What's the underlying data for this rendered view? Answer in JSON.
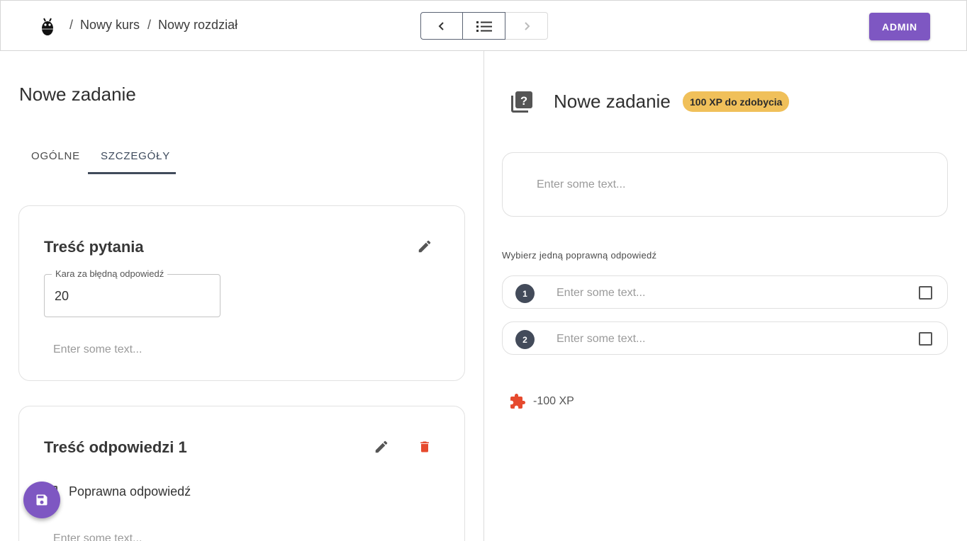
{
  "header": {
    "breadcrumb": [
      "Nowy kurs",
      "Nowy rozdział"
    ],
    "admin_label": "ADMIN"
  },
  "left": {
    "title": "Nowe zadanie",
    "tabs": [
      {
        "label": "OGÓLNE",
        "active": false
      },
      {
        "label": "SZCZEGÓŁY",
        "active": true
      }
    ],
    "question_card": {
      "title": "Treść pytania",
      "penalty_label": "Kara za błędną odpowiedź",
      "penalty_value": "20",
      "editor_placeholder": "Enter some text..."
    },
    "answer_card": {
      "title": "Treść odpowiedzi 1",
      "correct_label": "Poprawna odpowiedź",
      "editor_placeholder": "Enter some text..."
    }
  },
  "right": {
    "title": "Nowe zadanie",
    "xp_badge": "100 XP do zdobycia",
    "prompt_placeholder": "Enter some text...",
    "instruction": "Wybierz jedną poprawną odpowiedź",
    "answers": [
      {
        "number": "1",
        "placeholder": "Enter some text..."
      },
      {
        "number": "2",
        "placeholder": "Enter some text..."
      }
    ],
    "penalty": "-100 XP"
  },
  "colors": {
    "primary": "#7e57c2",
    "badge": "#f0c05a",
    "danger": "#e64a2e",
    "dark": "#434b5a"
  },
  "icons": [
    "bug-icon",
    "chevron-left-icon",
    "list-icon",
    "chevron-right-icon",
    "pencil-icon",
    "trash-icon",
    "save-icon",
    "question-library-icon",
    "puzzle-icon"
  ]
}
